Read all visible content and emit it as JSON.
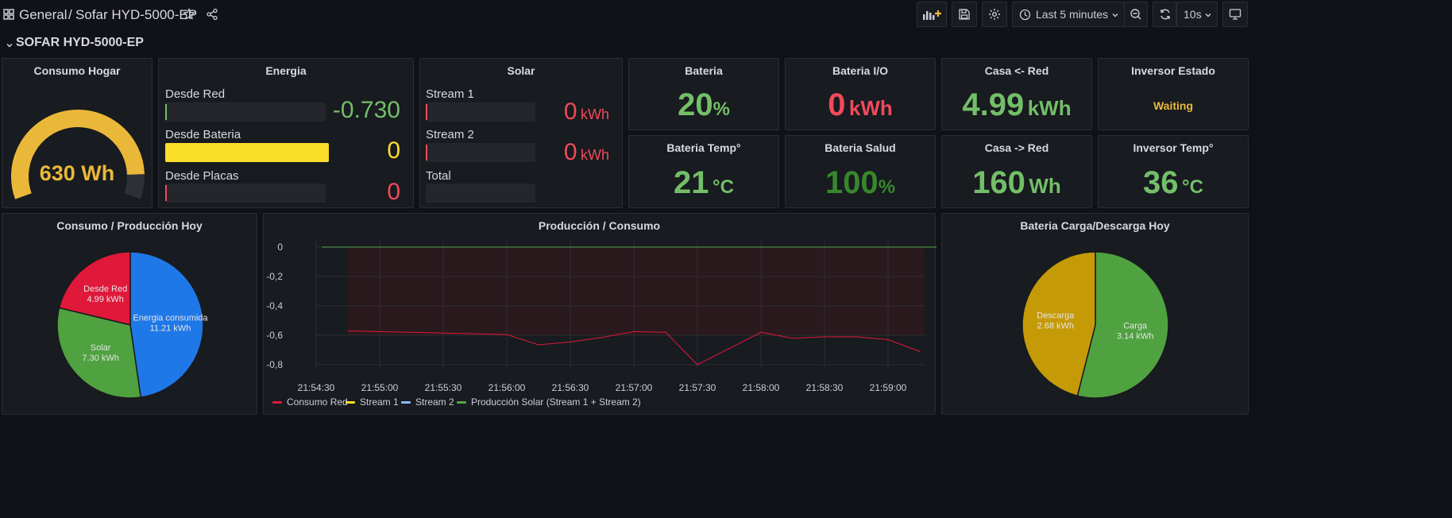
{
  "header": {
    "folder": "General",
    "separator": "/",
    "dashboard": "Sofar HYD-5000-EP",
    "time_range": "Last 5 minutes",
    "refresh": "10s"
  },
  "row_title": "SOFAR HYD-5000-EP",
  "colors": {
    "green": "#73bf69",
    "red": "#f2495c",
    "yellow": "#fade2a",
    "orange": "#eab839",
    "blue": "#5794f2"
  },
  "panels": {
    "consumo_hogar": {
      "title": "Consumo Hogar",
      "value": "630 Wh",
      "gauge_fraction": 0.9
    },
    "energia": {
      "title": "Energia",
      "rows": [
        {
          "label": "Desde Red",
          "value": "-0.730",
          "fraction": 0.0
        },
        {
          "label": "Desde Bateria",
          "value": "0",
          "fraction": 1.0
        },
        {
          "label": "Desde Placas",
          "value": "0",
          "fraction": 0.0
        }
      ]
    },
    "solar": {
      "title": "Solar",
      "rows": [
        {
          "label": "Stream 1",
          "value": "0",
          "unit": "kWh"
        },
        {
          "label": "Stream 2",
          "value": "0",
          "unit": "kWh"
        },
        {
          "label": "Total",
          "value": "",
          "unit": ""
        }
      ]
    },
    "bateria": {
      "title": "Bateria",
      "value": "20",
      "unit": "%"
    },
    "bateria_io": {
      "title": "Bateria I/O",
      "value": "0",
      "unit": "kWh"
    },
    "casa_red_in": {
      "title": "Casa <- Red",
      "value": "4.99",
      "unit": "kWh"
    },
    "inversor_estado": {
      "title": "Inversor Estado",
      "value": "Waiting"
    },
    "bateria_temp": {
      "title": "Bateria Temp°",
      "value": "21",
      "unit": "°C"
    },
    "bateria_salud": {
      "title": "Bateria Salud",
      "value": "100",
      "unit": "%"
    },
    "casa_red_out": {
      "title": "Casa -> Red",
      "value": "160",
      "unit": "Wh"
    },
    "inversor_temp": {
      "title": "Inversor Temp°",
      "value": "36",
      "unit": "°C"
    },
    "pie1": {
      "title": "Consumo / Producción Hoy",
      "slices": [
        {
          "label": "Energia consumida",
          "value_label": "11.21 kWh",
          "value": 11.21,
          "color": "#1f78e8"
        },
        {
          "label": "Solar",
          "value_label": "7.30 kWh",
          "value": 7.3,
          "color": "#4fa23f"
        },
        {
          "label": "Desde Red",
          "value_label": "4.99 kWh",
          "value": 4.99,
          "color": "#e0183a"
        }
      ]
    },
    "timeseries": {
      "title": "Producción / Consumo",
      "legend": [
        "Consumo Red",
        "Stream 1",
        "Stream 2",
        "Producción Solar (Stream 1 + Stream 2)"
      ]
    },
    "pie2": {
      "title": "Bateria Carga/Descarga Hoy",
      "slices": [
        {
          "label": "Carga",
          "value_label": "3.14 kWh",
          "value": 3.14,
          "color": "#4fa23f"
        },
        {
          "label": "Descarga",
          "value_label": "2.68 kWh",
          "value": 2.68,
          "color": "#c49a06"
        }
      ]
    }
  },
  "chart_data": {
    "type": "line",
    "title": "Producción / Consumo",
    "x_ticks": [
      "21:54:30",
      "21:55:00",
      "21:55:30",
      "21:56:00",
      "21:56:30",
      "21:57:00",
      "21:57:30",
      "21:58:00",
      "21:58:30",
      "21:59:00"
    ],
    "y_ticks": [
      "0",
      "-0,2",
      "-0,4",
      "-0,6",
      "-0,8"
    ],
    "ylim": [
      -0.85,
      0.03
    ],
    "series": [
      {
        "name": "Consumo Red",
        "color": "#e0183a",
        "x": [
          "21:54:45",
          "21:55:00",
          "21:55:15",
          "21:55:30",
          "21:55:45",
          "21:56:00",
          "21:56:15",
          "21:56:30",
          "21:56:45",
          "21:57:00",
          "21:57:15",
          "21:57:30",
          "21:57:45",
          "21:58:00",
          "21:58:15",
          "21:58:30",
          "21:58:45",
          "21:59:00",
          "21:59:15"
        ],
        "y": [
          -0.57,
          -0.575,
          -0.58,
          -0.585,
          -0.59,
          -0.595,
          -0.665,
          -0.645,
          -0.615,
          -0.575,
          -0.58,
          -0.8,
          -0.69,
          -0.58,
          -0.62,
          -0.61,
          -0.61,
          -0.63,
          -0.71
        ]
      },
      {
        "name": "Stream 1",
        "color": "#fade2a",
        "x": [],
        "y": []
      },
      {
        "name": "Stream 2",
        "color": "#8ab8ff",
        "x": [],
        "y": []
      },
      {
        "name": "Producción Solar (Stream 1 + Stream 2)",
        "color": "#56a64b",
        "x": [
          "21:54:33",
          "21:59:28"
        ],
        "y": [
          0,
          0
        ]
      }
    ],
    "grid": true,
    "legend_position": "bottom-left"
  }
}
